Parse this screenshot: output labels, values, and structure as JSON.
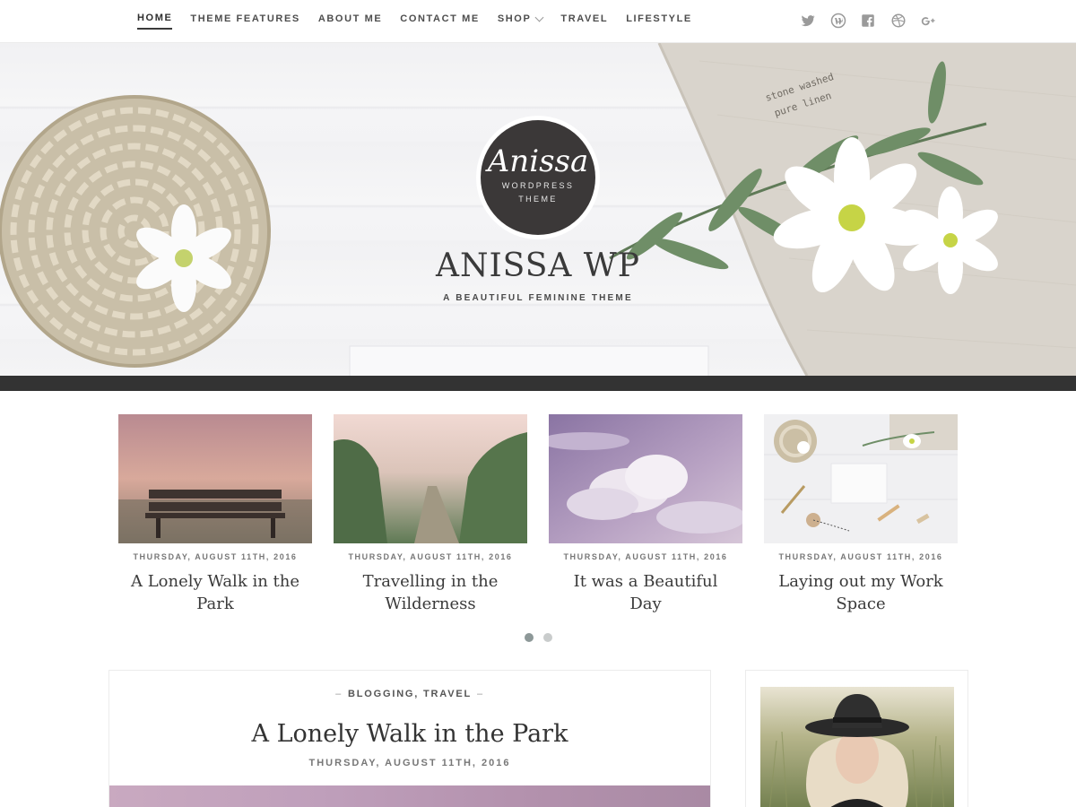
{
  "nav": {
    "items": [
      {
        "label": "HOME",
        "active": true
      },
      {
        "label": "THEME FEATURES"
      },
      {
        "label": "ABOUT ME"
      },
      {
        "label": "CONTACT ME"
      },
      {
        "label": "SHOP",
        "has_dropdown": true
      },
      {
        "label": "TRAVEL"
      },
      {
        "label": "LIFESTYLE"
      }
    ]
  },
  "social": {
    "icons": [
      "twitter-icon",
      "wordpress-icon",
      "facebook-icon",
      "dribbble-icon",
      "google-plus-icon"
    ]
  },
  "hero": {
    "logo_script": "Anissa",
    "logo_sub_1": "WORDPRESS",
    "logo_sub_2": "THEME",
    "site_title": "ANISSA WP",
    "tagline": "A BEAUTIFUL FEMININE THEME",
    "linen_text_1": "stone washed",
    "linen_text_2": "pure linen"
  },
  "slider": {
    "slides": [
      {
        "date": "THURSDAY, AUGUST 11TH, 2016",
        "title": "A Lonely Walk in the Park",
        "image": "bench-in-mist"
      },
      {
        "date": "THURSDAY, AUGUST 11TH, 2016",
        "title": "Travelling in the Wilderness",
        "image": "misty-forest-path"
      },
      {
        "date": "THURSDAY, AUGUST 11TH, 2016",
        "title": "It was a Beautiful Day",
        "image": "purple-clouds"
      },
      {
        "date": "THURSDAY, AUGUST 11TH, 2016",
        "title": "Laying out my Work Space",
        "image": "workspace-flatlay"
      }
    ],
    "dots": 2,
    "active_dot": 0
  },
  "post": {
    "categories": [
      "BLOGGING",
      "TRAVEL"
    ],
    "dash": "–",
    "separator": ",",
    "title": "A Lonely Walk in the Park",
    "date": "THURSDAY, AUGUST 11TH, 2016"
  },
  "sidebar": {
    "photo": "woman-in-black-hat"
  },
  "colors": {
    "dark_bar": "#333333",
    "text": "#3a3a3a",
    "muted": "#777777",
    "dot_active": "#8d9898",
    "dot_inactive": "#c9cccc"
  }
}
